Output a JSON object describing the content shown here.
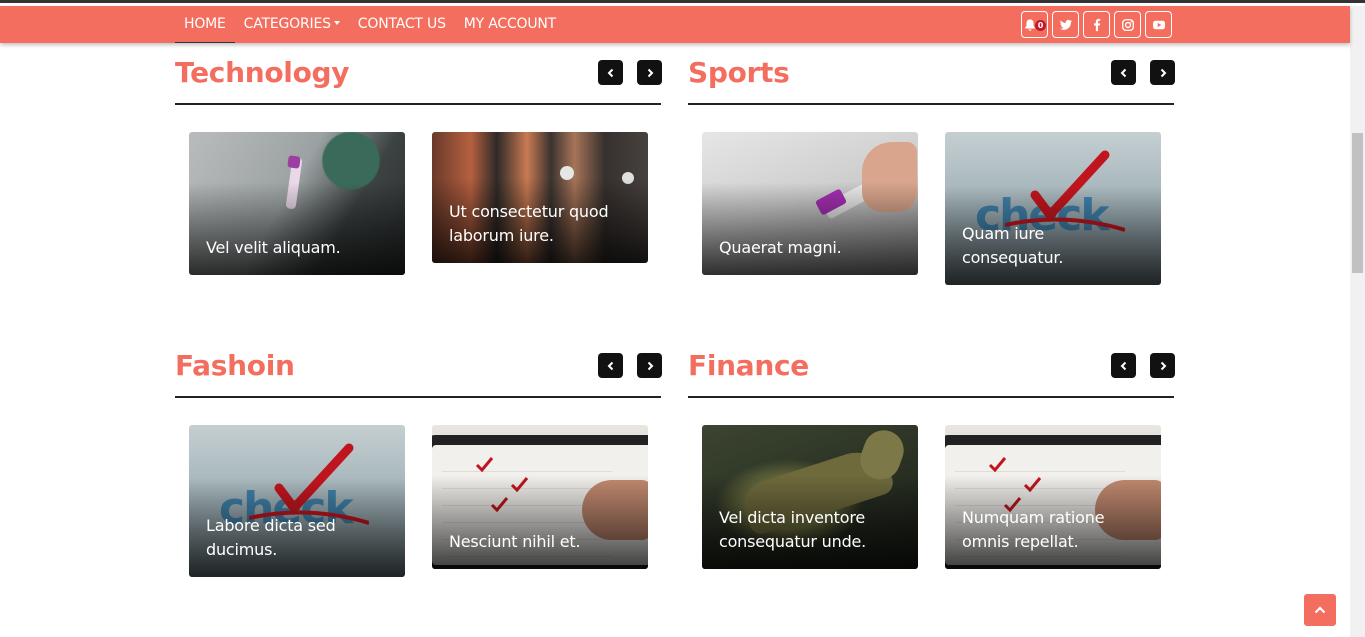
{
  "nav": {
    "items": [
      {
        "label": "HOME",
        "active": true
      },
      {
        "label": "CATEGORIES",
        "has_dropdown": true
      },
      {
        "label": "CONTACT US"
      },
      {
        "label": "MY ACCOUNT"
      }
    ],
    "notification_count": "0",
    "social": [
      "bell-icon",
      "twitter-icon",
      "facebook-icon",
      "instagram-icon",
      "youtube-icon"
    ]
  },
  "colors": {
    "accent": "#f46e5f",
    "dark": "#111111",
    "badge": "#c0182c"
  },
  "sections": [
    {
      "title": "Technology",
      "posts": [
        {
          "caption": "Vel velit aliquam.",
          "image": "lab-test-tube-photo"
        },
        {
          "caption": "Ut consectetur quod laborum iure.",
          "image": "queue-masks-photo"
        }
      ]
    },
    {
      "title": "Sports",
      "posts": [
        {
          "caption": "Quaerat magni.",
          "image": "marker-hand-photo"
        },
        {
          "caption": "Quam iure consequatur.",
          "image": "check-mark-photo"
        }
      ]
    },
    {
      "title": "Fashoin",
      "posts": [
        {
          "caption": "Labore dicta sed ducimus.",
          "image": "check-mark-photo"
        },
        {
          "caption": "Nesciunt nihil et.",
          "image": "answer-sheet-tablet-photo"
        }
      ]
    },
    {
      "title": "Finance",
      "posts": [
        {
          "caption": "Vel dicta inventore consequatur unde.",
          "image": "lizard-photo"
        },
        {
          "caption": "Numquam ratione omnis repellat.",
          "image": "answer-sheet-tablet-photo"
        }
      ]
    }
  ]
}
